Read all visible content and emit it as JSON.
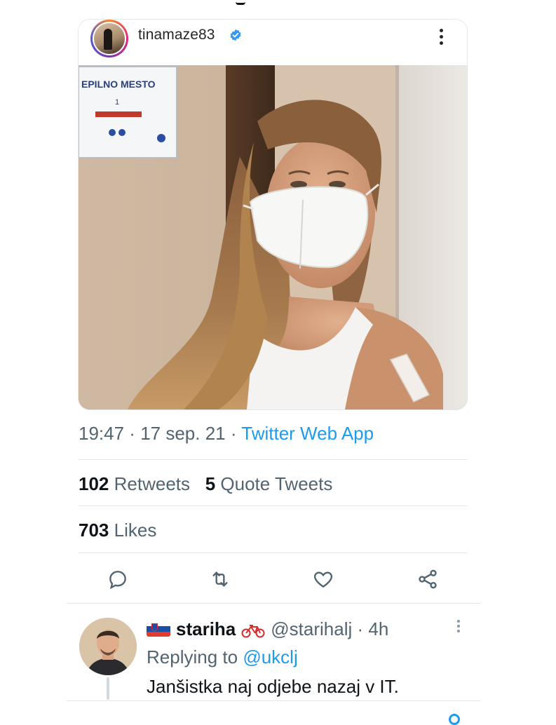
{
  "instagram_post": {
    "username": "tinamaze83",
    "verified": true,
    "avatar_icon": "profile-avatar",
    "more_icon": "more-vertical-icon",
    "photo": {
      "sign_text_line1": "EPILNO MESTO",
      "sign_text_line2": "1"
    }
  },
  "tweet": {
    "time": "19:47",
    "date": "17 sep. 21",
    "separator": " · ",
    "source": "Twitter Web App",
    "retweets_count": "102",
    "retweets_label": "Retweets",
    "quote_count": "5",
    "quote_label": "Quote Tweets",
    "likes_count": "703",
    "likes_label": "Likes",
    "actions": [
      "reply-icon",
      "retweet-icon",
      "like-icon",
      "share-icon"
    ]
  },
  "reply": {
    "flag_icon": "slovenia-flag-icon",
    "display_name": "stariha",
    "name_emoji_icon": "bicycle-icon",
    "handle": "@starihalj",
    "age": "4h",
    "replying_prefix": "Replying to",
    "replying_to": "@ukclj",
    "text": "Janšistka naj odjebe nazaj v IT."
  },
  "colors": {
    "link_blue": "#1d9bf0",
    "verified_blue": "#3897f0",
    "muted_text": "#536471",
    "primary_text": "#0f1419"
  }
}
